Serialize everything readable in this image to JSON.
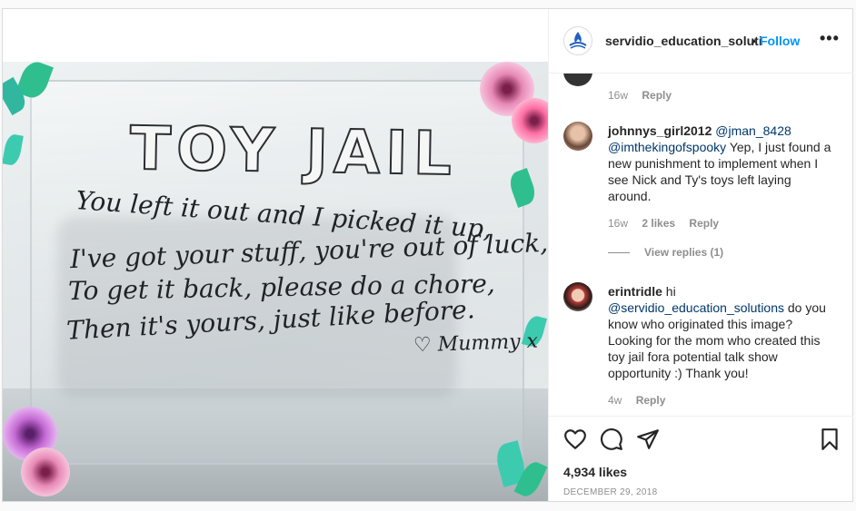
{
  "post": {
    "username": "servidio_education_soluti",
    "separator": "•",
    "follow_label": "Follow",
    "more_label": "•••",
    "image_text": {
      "title": "TOY JAIL",
      "lines": [
        "You left it out and I picked it up,",
        "I've got your stuff, you're out of luck,",
        "To get it back, please do a chore,",
        "Then it's yours, just like before."
      ],
      "signature": "♡ Mummy x"
    }
  },
  "comments": [
    {
      "time": "16w",
      "reply_label": "Reply"
    },
    {
      "username": "johnnys_girl2012",
      "mention1": "@jman_8428",
      "mention2": "@imthekingofspooky",
      "text": "Yep, I just found a new punishment to implement when I see Nick and Ty's toys left laying around.",
      "time": "16w",
      "likes": "2 likes",
      "reply_label": "Reply",
      "view_replies": "View replies (1)"
    },
    {
      "username": "erintridle",
      "greeting": "hi",
      "mention": "@servidio_education_solutions",
      "text": "do you know who originated this image? Looking for the mom who created this toy jail fora potential talk show opportunity :) Thank you!",
      "time": "4w",
      "reply_label": "Reply"
    }
  ],
  "actions": {
    "icons": [
      "heart-icon",
      "comment-icon",
      "share-icon",
      "bookmark-icon"
    ],
    "likes_count": "4,934 likes",
    "date": "DECEMBER 29, 2018"
  },
  "colors": {
    "follow": "#0095f6",
    "mention": "#00376b",
    "muted": "#8e8e8e"
  }
}
